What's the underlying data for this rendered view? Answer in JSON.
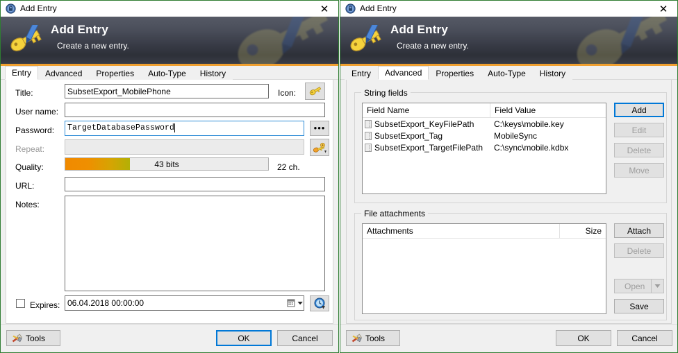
{
  "left_window": {
    "titlebar": {
      "icon": "lock-circle-icon",
      "title": "Add Entry",
      "close": "✕"
    },
    "banner": {
      "icon": "key-pen-icon",
      "title": "Add Entry",
      "subtitle": "Create a new entry."
    },
    "tabs": [
      {
        "label": "Entry",
        "active": true
      },
      {
        "label": "Advanced",
        "active": false
      },
      {
        "label": "Properties",
        "active": false
      },
      {
        "label": "Auto-Type",
        "active": false
      },
      {
        "label": "History",
        "active": false
      }
    ],
    "fields": {
      "title_label": "Title:",
      "title_value": "SubsetExport_MobilePhone",
      "icon_label": "Icon:",
      "icon_button": "key-icon",
      "username_label": "User name:",
      "username_value": "",
      "password_label": "Password:",
      "password_value": "TargetDatabasePassword",
      "password_dots_button": "•••",
      "repeat_label": "Repeat:",
      "repeat_value": "",
      "repeat_button": "key-gear-icon",
      "quality_label": "Quality:",
      "quality_bits": "43 bits",
      "quality_chars": "22 ch.",
      "quality_percent": 32,
      "url_label": "URL:",
      "url_value": "",
      "notes_label": "Notes:",
      "notes_value": "",
      "expires_label": "Expires:",
      "expires_checked": false,
      "expires_value": "06.04.2018 00:00:00",
      "expires_calendar_icon": "calendar-dropdown-icon",
      "expires_clock_button": "clock-icon"
    },
    "footer": {
      "tools": "Tools",
      "tools_icon": "tools-icon",
      "ok": "OK",
      "cancel": "Cancel"
    }
  },
  "right_window": {
    "titlebar": {
      "icon": "lock-circle-icon",
      "title": "Add Entry",
      "close": "✕"
    },
    "banner": {
      "icon": "key-pen-icon",
      "title": "Add Entry",
      "subtitle": "Create a new entry."
    },
    "tabs": [
      {
        "label": "Entry",
        "active": false
      },
      {
        "label": "Advanced",
        "active": true
      },
      {
        "label": "Properties",
        "active": false
      },
      {
        "label": "Auto-Type",
        "active": false
      },
      {
        "label": "History",
        "active": false
      }
    ],
    "string_fields": {
      "group_title": "String fields",
      "columns": [
        "Field Name",
        "Field Value"
      ],
      "rows": [
        {
          "name": "SubsetExport_KeyFilePath",
          "value": "C:\\keys\\mobile.key",
          "icon": "string-field-icon"
        },
        {
          "name": "SubsetExport_Tag",
          "value": "MobileSync",
          "icon": "string-field-icon"
        },
        {
          "name": "SubsetExport_TargetFilePath",
          "value": "C:\\sync\\mobile.kdbx",
          "icon": "string-field-icon"
        }
      ],
      "buttons": [
        {
          "label": "Add",
          "state": "focused"
        },
        {
          "label": "Edit",
          "state": "disabled"
        },
        {
          "label": "Delete",
          "state": "disabled"
        },
        {
          "label": "Move",
          "state": "disabled"
        }
      ]
    },
    "file_attachments": {
      "group_title": "File attachments",
      "columns": [
        "Attachments",
        "Size"
      ],
      "rows": [],
      "buttons": [
        {
          "label": "Attach",
          "state": "enabled"
        },
        {
          "label": "Delete",
          "state": "disabled"
        },
        {
          "label": "Open",
          "state": "disabled",
          "split": true
        },
        {
          "label": "Save",
          "state": "enabled"
        }
      ]
    },
    "footer": {
      "tools": "Tools",
      "tools_icon": "tools-icon",
      "ok": "OK",
      "cancel": "Cancel"
    }
  },
  "colors": {
    "window_border": "#2f7d32",
    "banner_accent": "#f0a030",
    "focus_blue": "#0078d7",
    "quality_start": "#f08a00",
    "quality_end": "#b3b005"
  }
}
